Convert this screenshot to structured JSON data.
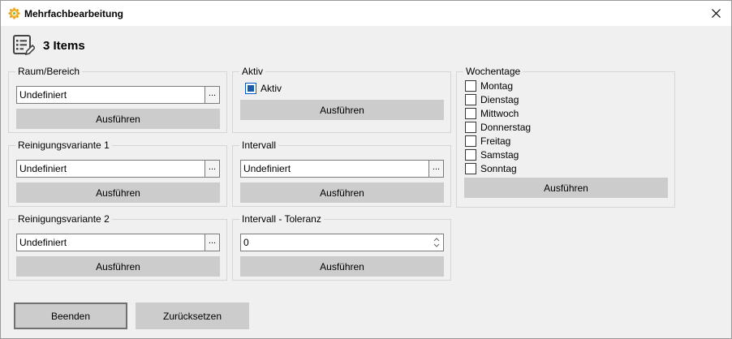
{
  "window": {
    "title": "Mehrfachbearbeitung"
  },
  "header": {
    "title": "3 Items"
  },
  "raum": {
    "legend": "Raum/Bereich",
    "value": "Undefiniert",
    "browse": "...",
    "action": "Ausführen"
  },
  "variante1": {
    "legend": "Reinigungsvariante 1",
    "value": "Undefiniert",
    "browse": "...",
    "action": "Ausführen"
  },
  "variante2": {
    "legend": "Reinigungsvariante 2",
    "value": "Undefiniert",
    "browse": "...",
    "action": "Ausführen"
  },
  "aktiv": {
    "legend": "Aktiv",
    "checkbox_label": "Aktiv",
    "checked": true,
    "action": "Ausführen"
  },
  "intervall": {
    "legend": "Intervall",
    "value": "Undefiniert",
    "browse": "...",
    "action": "Ausführen"
  },
  "toleranz": {
    "legend": "Intervall - Toleranz",
    "value": "0",
    "action": "Ausführen"
  },
  "wochentage": {
    "legend": "Wochentage",
    "days": [
      "Montag",
      "Dienstag",
      "Mittwoch",
      "Donnerstag",
      "Freitag",
      "Samstag",
      "Sonntag"
    ],
    "action": "Ausführen"
  },
  "footer": {
    "close_label": "Beenden",
    "reset_label": "Zurücksetzen"
  },
  "colors": {
    "accent": "#1e5aa8",
    "button": "#cccccc",
    "background": "#f0f0f0"
  }
}
